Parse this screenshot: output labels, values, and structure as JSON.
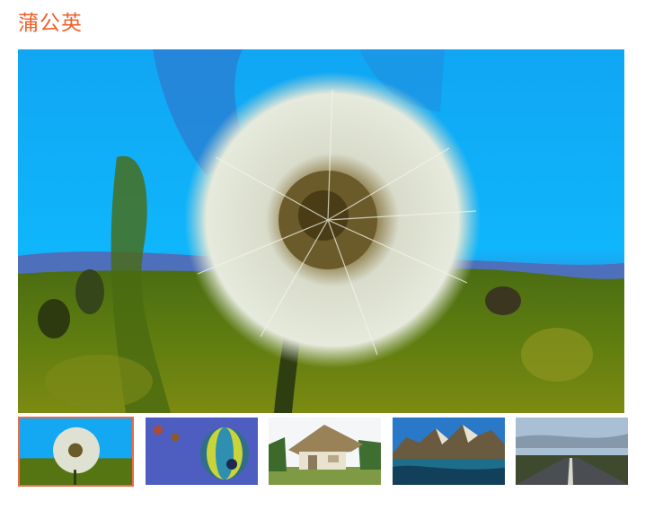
{
  "gallery": {
    "title": "蒲公英",
    "accent_color": "#f0602a",
    "main_image": "dandelion",
    "selected_index": 0,
    "thumbnails": [
      {
        "subject": "dandelion"
      },
      {
        "subject": "hot-air-balloons"
      },
      {
        "subject": "thatched-hut"
      },
      {
        "subject": "mountain-lake"
      },
      {
        "subject": "highway-sunset"
      }
    ]
  }
}
